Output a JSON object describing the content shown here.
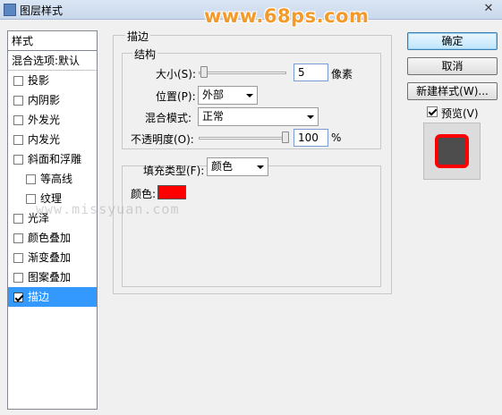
{
  "window": {
    "title": "图层样式",
    "watermark": "www.68ps.com",
    "close_glyph": "✕"
  },
  "style_list": {
    "header": "样式",
    "blend_item": "混合选项:默认",
    "items": [
      {
        "label": "投影",
        "checked": false,
        "indent": false,
        "selected": false
      },
      {
        "label": "内阴影",
        "checked": false,
        "indent": false,
        "selected": false
      },
      {
        "label": "外发光",
        "checked": false,
        "indent": false,
        "selected": false
      },
      {
        "label": "内发光",
        "checked": false,
        "indent": false,
        "selected": false
      },
      {
        "label": "斜面和浮雕",
        "checked": false,
        "indent": false,
        "selected": false
      },
      {
        "label": "等高线",
        "checked": false,
        "indent": true,
        "selected": false
      },
      {
        "label": "纹理",
        "checked": false,
        "indent": true,
        "selected": false
      },
      {
        "label": "光泽",
        "checked": false,
        "indent": false,
        "selected": false
      },
      {
        "label": "颜色叠加",
        "checked": false,
        "indent": false,
        "selected": false
      },
      {
        "label": "渐变叠加",
        "checked": false,
        "indent": false,
        "selected": false
      },
      {
        "label": "图案叠加",
        "checked": false,
        "indent": false,
        "selected": false
      },
      {
        "label": "描边",
        "checked": true,
        "indent": false,
        "selected": true
      }
    ]
  },
  "stroke": {
    "section_title": "描边",
    "structure_title": "结构",
    "size_label": "大小(S):",
    "size_value": "5",
    "size_unit": "像素",
    "position_label": "位置(P):",
    "position_value": "外部",
    "blend_label": "混合模式:",
    "blend_value": "正常",
    "opacity_label": "不透明度(O):",
    "opacity_value": "100",
    "opacity_unit": "%",
    "fill_type_label": "填充类型(F):",
    "fill_type_value": "颜色",
    "color_label": "颜色:",
    "color": "#ff0000"
  },
  "ghost_text": "www.missyuan.com",
  "buttons": {
    "ok": "确定",
    "cancel": "取消",
    "new_style": "新建样式(W)...",
    "preview_label": "预览(V)",
    "preview_checked": true
  },
  "preview": {
    "fill_color": "#4d4d4d",
    "stroke_color": "#ff0000"
  }
}
